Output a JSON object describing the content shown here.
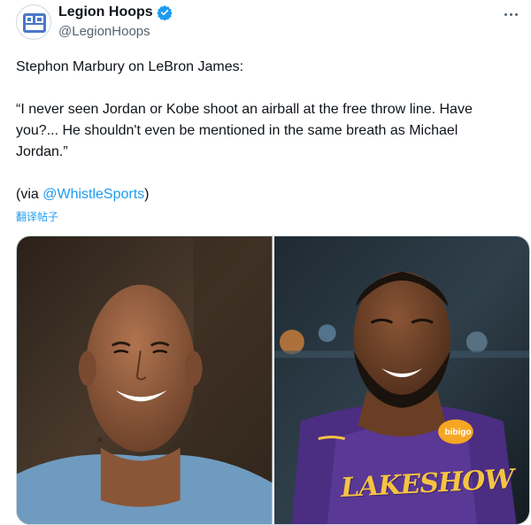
{
  "author": {
    "display_name": "Legion Hoops",
    "handle": "@LegionHoops",
    "verified_icon": "verified-badge-icon",
    "avatar_icon": "legion-hoops-logo"
  },
  "tweet": {
    "line1": "Stephon Marbury on LeBron James:",
    "quote_line1": "“I never seen Jordan or Kobe shoot an airball at the free throw line. Have",
    "quote_line2": "you?... He shouldn't even be mentioned in the same breath as Michael",
    "quote_line3": "Jordan.”",
    "via_prefix": "(via ",
    "via_mention": "@WhistleSports",
    "via_suffix": ")",
    "translate_label": "翻译帖子"
  },
  "media": {
    "photos": [
      {
        "subject": "stephon-marbury-photo"
      },
      {
        "subject": "lebron-james-photo",
        "jersey_text": "LAKESHOW",
        "badge_text": "bibigo"
      }
    ]
  },
  "colors": {
    "accent": "#1d9bf0",
    "text": "#0f1419",
    "secondary": "#536471"
  }
}
